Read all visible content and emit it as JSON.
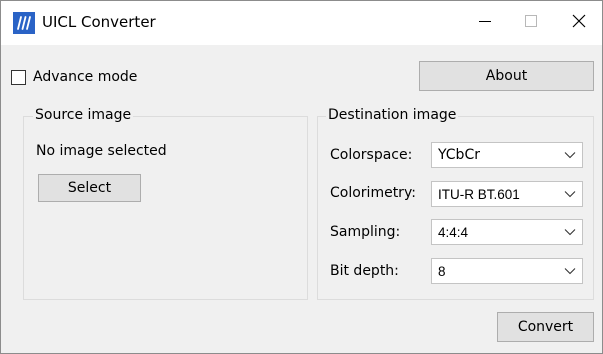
{
  "window": {
    "title": "UICL Converter",
    "icon": "app-logo-icon",
    "controls": [
      "minimize-icon",
      "maximize-icon",
      "close-icon"
    ]
  },
  "options": {
    "advance_mode_label": "Advance mode",
    "advance_mode_checked": false,
    "about_label": "About"
  },
  "source": {
    "group_label": "Source image",
    "status": "No image selected",
    "select_label": "Select"
  },
  "destination": {
    "group_label": "Destination image",
    "fields": [
      {
        "label": "Colorspace:",
        "value": "YCbCr"
      },
      {
        "label": "Colorimetry:",
        "value": "ITU-R BT.601"
      },
      {
        "label": "Sampling:",
        "value": "4:4:4"
      },
      {
        "label": "Bit depth:",
        "value": "8"
      }
    ]
  },
  "actions": {
    "convert_label": "Convert"
  },
  "colors": {
    "accent": "#1f5fbf",
    "window_bg": "#f0f0f0",
    "button_bg": "#e1e1e1",
    "button_border": "#adadad"
  }
}
